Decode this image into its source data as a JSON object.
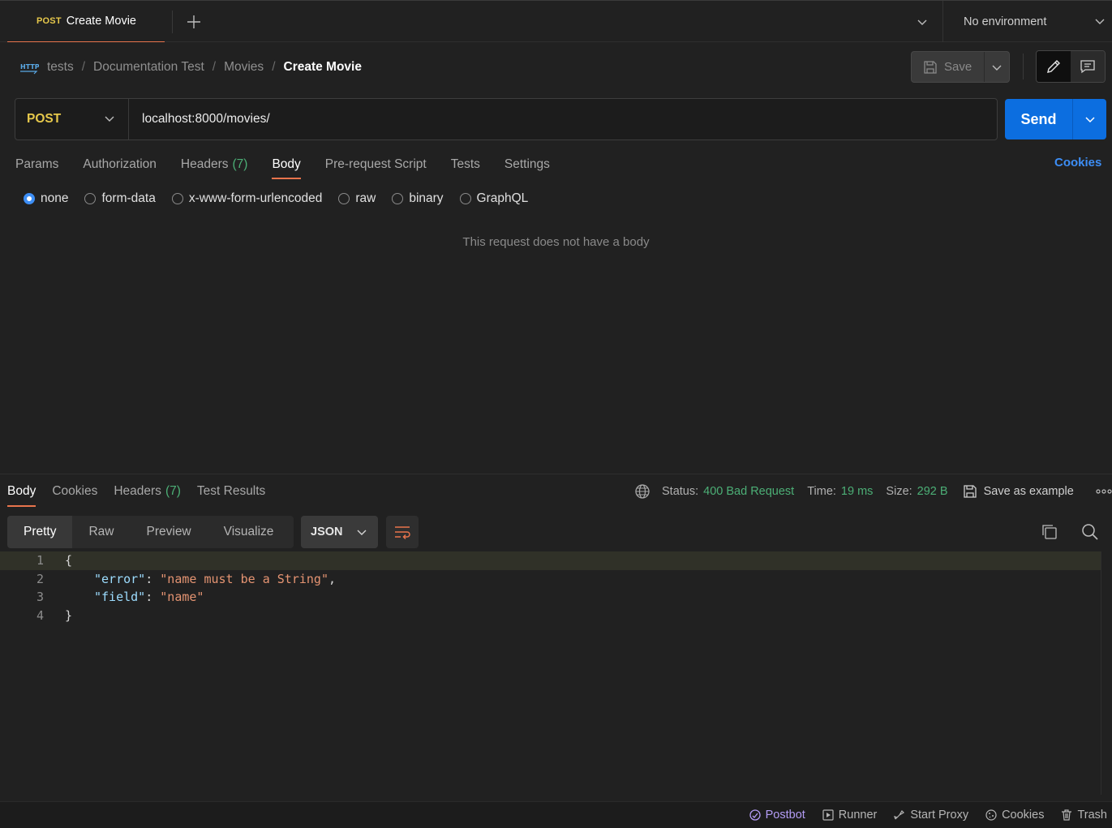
{
  "tab": {
    "method": "POST",
    "name": "Create Movie"
  },
  "environment": {
    "label": "No environment"
  },
  "breadcrumb": {
    "items": [
      "tests",
      "Documentation Test",
      "Movies"
    ],
    "current": "Create Movie",
    "separator": "/"
  },
  "toolbar": {
    "save_label": "Save"
  },
  "request": {
    "method": "POST",
    "url": "localhost:8000/movies/",
    "send_label": "Send"
  },
  "request_tabs": [
    {
      "label": "Params",
      "count": ""
    },
    {
      "label": "Authorization",
      "count": ""
    },
    {
      "label": "Headers",
      "count": "(7)"
    },
    {
      "label": "Body",
      "count": ""
    },
    {
      "label": "Pre-request Script",
      "count": ""
    },
    {
      "label": "Tests",
      "count": ""
    },
    {
      "label": "Settings",
      "count": ""
    }
  ],
  "cookies_link": "Cookies",
  "body_options": [
    "none",
    "form-data",
    "x-www-form-urlencoded",
    "raw",
    "binary",
    "GraphQL"
  ],
  "body_selected": "none",
  "no_body_message": "This request does not have a body",
  "response": {
    "tabs": [
      {
        "label": "Body",
        "count": ""
      },
      {
        "label": "Cookies",
        "count": ""
      },
      {
        "label": "Headers",
        "count": "(7)"
      },
      {
        "label": "Test Results",
        "count": ""
      }
    ],
    "status_label": "Status:",
    "status_value": "400 Bad Request",
    "time_label": "Time:",
    "time_value": "19 ms",
    "size_label": "Size:",
    "size_value": "292 B",
    "save_example_label": "Save as example",
    "view_modes": [
      "Pretty",
      "Raw",
      "Preview",
      "Visualize"
    ],
    "format": "JSON",
    "code_lines": [
      {
        "n": "1",
        "text": "{"
      },
      {
        "n": "2",
        "key": "\"error\"",
        "value": "\"name must be a String\"",
        "trail": ","
      },
      {
        "n": "3",
        "key": "\"field\"",
        "value": "\"name\"",
        "trail": ""
      },
      {
        "n": "4",
        "text": "}"
      }
    ]
  },
  "statusbar": {
    "postbot": "Postbot",
    "runner": "Runner",
    "start_proxy": "Start Proxy",
    "cookies": "Cookies",
    "trash": "Trash"
  },
  "colors": {
    "accent": "#e8744c",
    "send": "#0c6ee0",
    "method": "#e6c84b",
    "success_text": "#4caf76",
    "link": "#3d8ef5"
  }
}
